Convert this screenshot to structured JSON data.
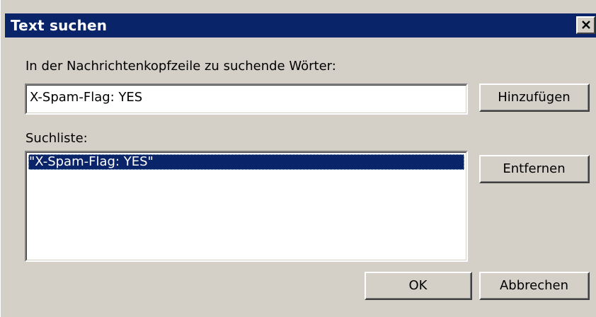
{
  "window": {
    "title": "Text suchen",
    "close_icon": "close-icon"
  },
  "search": {
    "label": "In der Nachrichtenkopfzeile zu suchende Wörter:",
    "value": "X-Spam-Flag: YES"
  },
  "list": {
    "label": "Suchliste:",
    "items": [
      "\"X-Spam-Flag: YES\""
    ]
  },
  "buttons": {
    "add": "Hinzufügen",
    "remove": "Entfernen",
    "ok": "OK",
    "cancel": "Abbrechen"
  },
  "colors": {
    "titlebar": "#0a246a",
    "dialog_bg": "#d4d0c8",
    "selection": "#0a246a"
  }
}
